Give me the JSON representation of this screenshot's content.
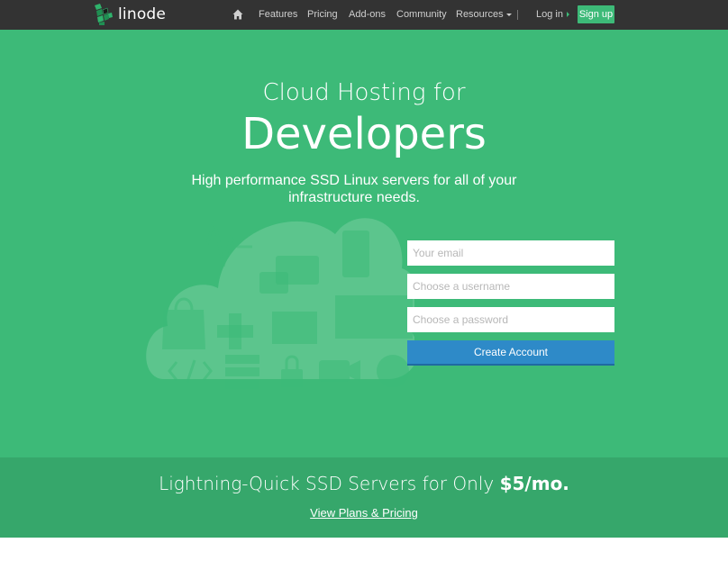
{
  "nav": {
    "brand": "linode",
    "items": [
      "Features",
      "Pricing",
      "Add-ons",
      "Community",
      "Resources"
    ],
    "login": "Log in",
    "signup": "Sign up"
  },
  "hero": {
    "line1": "Cloud Hosting for",
    "line2": "Developers",
    "subtitle": "High performance SSD Linux servers for all of your infrastructure needs.",
    "form": {
      "email_placeholder": "Your email",
      "username_placeholder": "Choose a username",
      "password_placeholder": "Choose a password",
      "submit": "Create Account"
    }
  },
  "promo": {
    "text": "Lightning-Quick SSD Servers for Only",
    "price": "$5/mo.",
    "link": "View Plans & Pricing"
  },
  "colors": {
    "nav_bg": "#333333",
    "brand_green": "#3dba78",
    "promo_green": "#36a76b",
    "button_blue": "#2e8ac8"
  }
}
